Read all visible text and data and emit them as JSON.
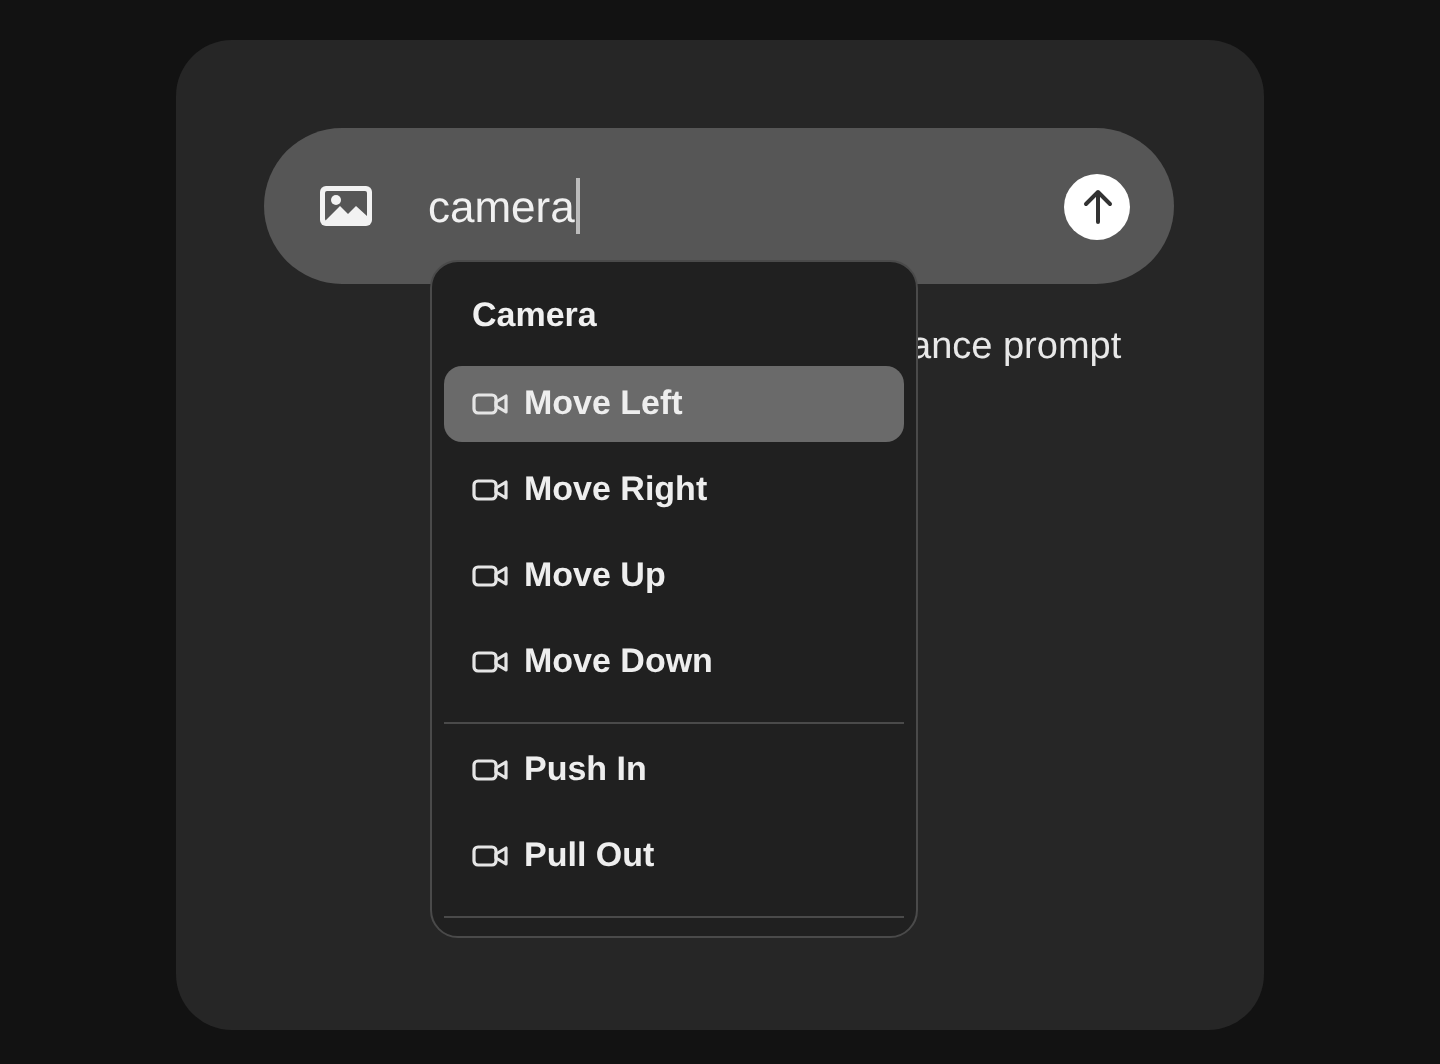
{
  "prompt": {
    "value": "camera"
  },
  "hint": "ance prompt",
  "menu": {
    "title": "Camera",
    "groups": [
      {
        "items": [
          {
            "label": "Move Left",
            "selected": true
          },
          {
            "label": "Move Right",
            "selected": false
          },
          {
            "label": "Move Up",
            "selected": false
          },
          {
            "label": "Move Down",
            "selected": false
          }
        ]
      },
      {
        "items": [
          {
            "label": "Push In",
            "selected": false
          },
          {
            "label": "Pull Out",
            "selected": false
          }
        ]
      }
    ]
  }
}
